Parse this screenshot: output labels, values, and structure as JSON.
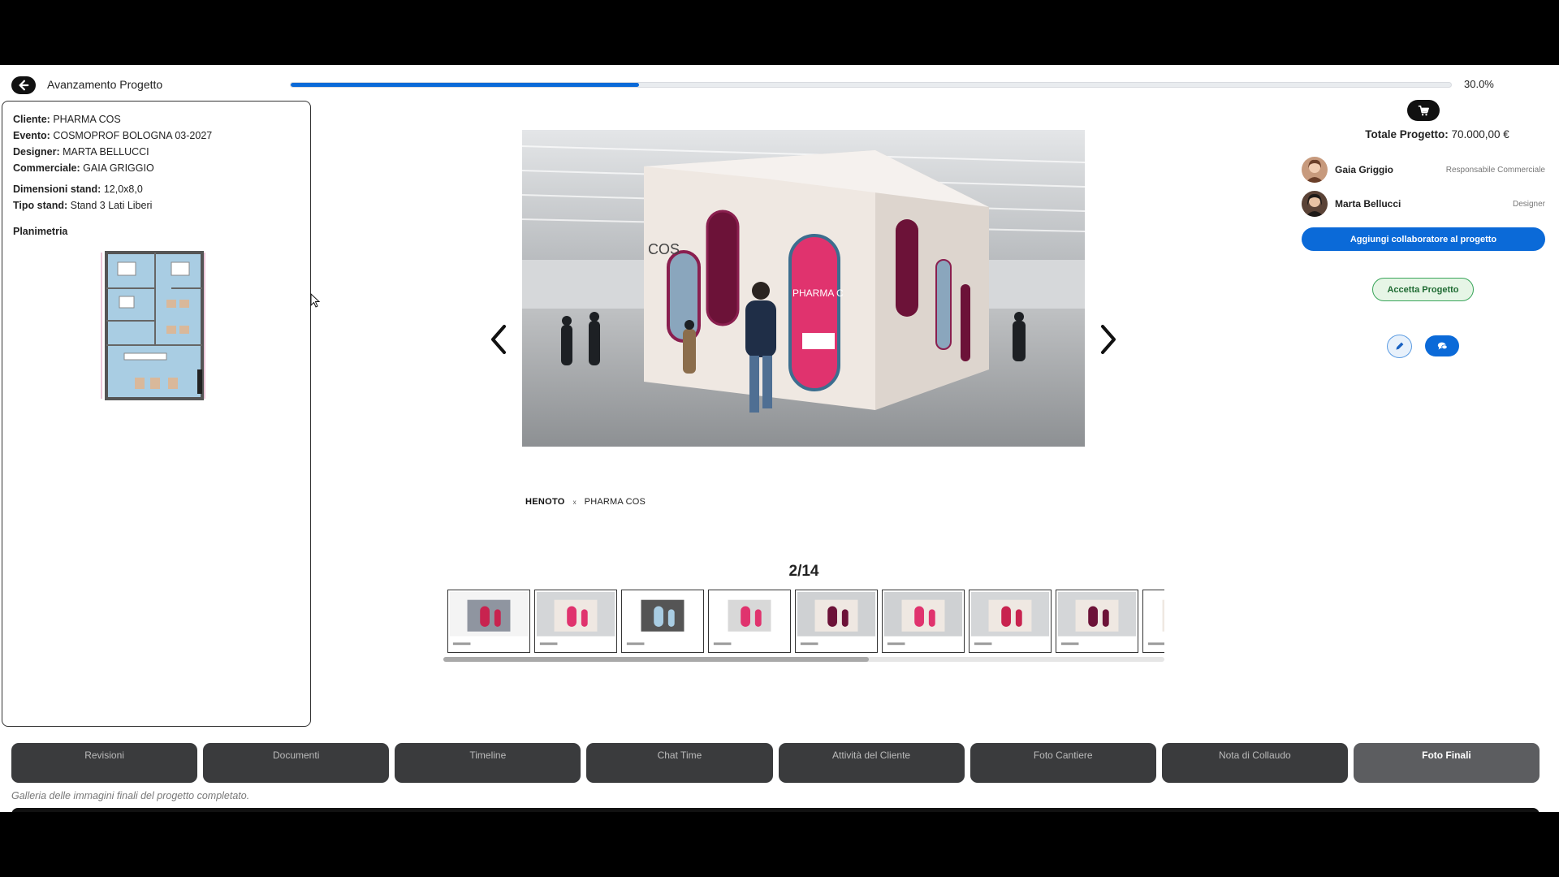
{
  "header": {
    "title": "Avanzamento Progetto",
    "progress_value": 30.0,
    "progress_label": "30.0%",
    "back_icon": "arrow-left-icon"
  },
  "info": {
    "cliente_label": "Cliente:",
    "cliente": "PHARMA COS",
    "evento_label": "Evento:",
    "evento": "COSMOPROF BOLOGNA 03-2027",
    "designer_label": "Designer:",
    "designer": "MARTA BELLUCCI",
    "commerciale_label": "Commerciale:",
    "commerciale": "GAIA GRIGGIO",
    "dimensioni_label": "Dimensioni stand:",
    "dimensioni": "12,0x8,0",
    "tipo_label": "Tipo stand:",
    "tipo": "Stand 3 Lati Liberi",
    "planimetria_label": "Planimetria"
  },
  "viewer": {
    "counter": "2/14",
    "current": 2,
    "total": 14,
    "prev_icon": "chevron-left-icon",
    "next_icon": "chevron-right-icon",
    "brand_left": "HENOTO",
    "brand_x": "x",
    "brand_right": "PHARMA COS",
    "image_text_left": "COS",
    "image_text_arch": "PHARMA C",
    "thumbnails_visible": 9,
    "thumb_scroll_fraction": 0.59
  },
  "right": {
    "cart_icon": "cart-icon",
    "total_label": "Totale Progetto:",
    "total_value": "70.000,00 €",
    "collaborators": [
      {
        "name": "Gaia Griggio",
        "role": "Responsabile Commerciale"
      },
      {
        "name": "Marta Bellucci",
        "role": "Designer"
      }
    ],
    "add_collab_label": "Aggiungi collaboratore al progetto",
    "accept_label": "Accetta Progetto",
    "edit_icon": "pencil-icon",
    "chat_icon": "chat-icon"
  },
  "tabs": [
    {
      "label": "Revisioni",
      "active": false
    },
    {
      "label": "Documenti",
      "active": false
    },
    {
      "label": "Timeline",
      "active": false
    },
    {
      "label": "Chat Time",
      "active": false
    },
    {
      "label": "Attività del Cliente",
      "active": false
    },
    {
      "label": "Foto Cantiere",
      "active": false
    },
    {
      "label": "Nota di Collaudo",
      "active": false
    },
    {
      "label": "Foto Finali",
      "active": true
    }
  ],
  "tab_description": "Galleria delle immagini finali del progetto completato.",
  "colors": {
    "accent": "#0b6ad8",
    "tab_bg": "#3a3b3d",
    "tab_active_bg": "#5c5d60",
    "accept_border": "#3aa55a",
    "stand_pink": "#e0336e"
  }
}
